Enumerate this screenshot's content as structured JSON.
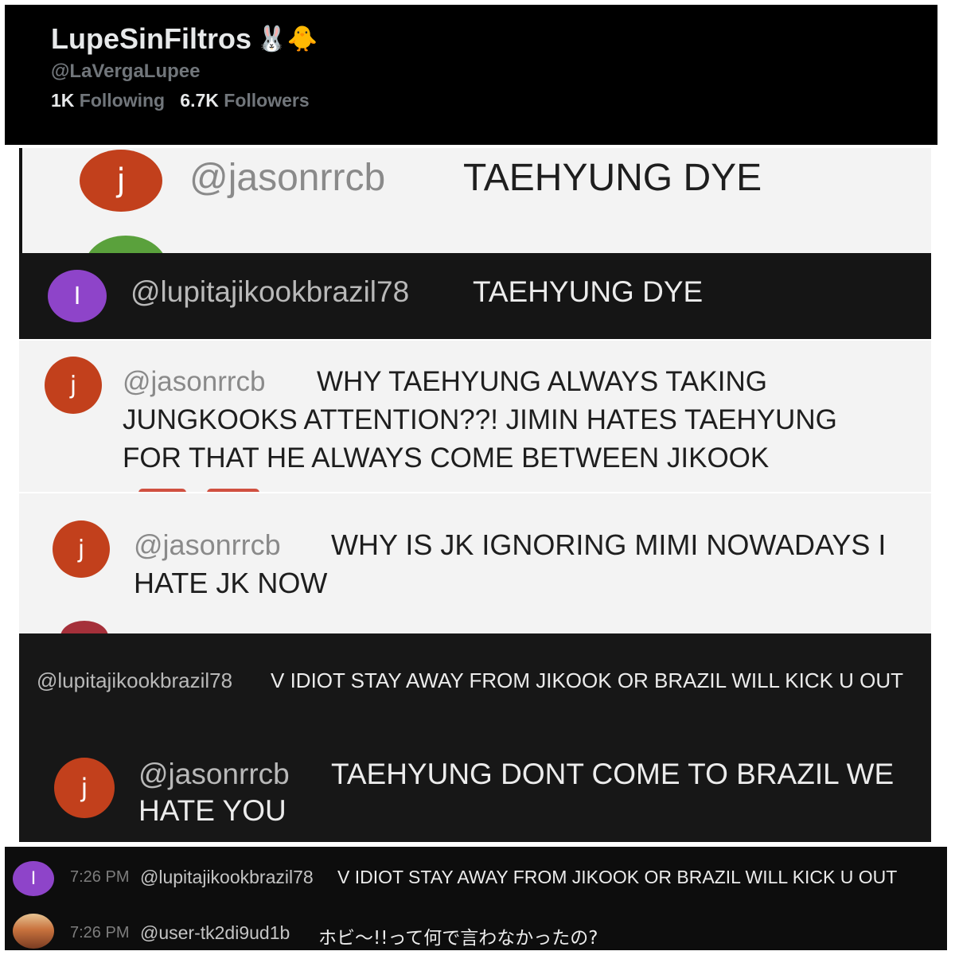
{
  "profile": {
    "name": "LupeSinFiltros",
    "emoji": "🐰🐥",
    "handle": "@LaVergaLupee",
    "following_count": "1K",
    "following_label": "Following",
    "followers_count": "6.7K",
    "followers_label": "Followers"
  },
  "comments": [
    {
      "avatar": "j",
      "handle": "@jasonrrcb",
      "text": "TAEHYUNG DYE"
    },
    {
      "avatar": "I",
      "handle": "@lupitajikookbrazil78",
      "text": "TAEHYUNG DYE"
    },
    {
      "avatar": "j",
      "handle": "@jasonrrcb",
      "text_lines": [
        "WHY TAEHYUNG ALWAYS TAKING",
        "JUNGKOOKS ATTENTION??! JIMIN HATES TAEHYUNG",
        "FOR THAT HE ALWAYS COME BETWEEN JIKOOK"
      ]
    },
    {
      "avatar": "j",
      "handle": "@jasonrrcb",
      "text_lines": [
        "WHY IS JK IGNORING MIMI NOWADAYS I",
        "HATE JK NOW"
      ]
    },
    {
      "handle": "@lupitajikookbrazil78",
      "text": "V IDIOT STAY AWAY FROM JIKOOK OR BRAZIL WILL KICK U OUT"
    },
    {
      "avatar": "j",
      "handle": "@jasonrrcb",
      "text_lines": [
        "TAEHYUNG DONT COME TO BRAZIL WE",
        "HATE YOU"
      ]
    }
  ],
  "chat": [
    {
      "avatar": "I",
      "time": "7:26 PM",
      "handle": "@lupitajikookbrazil78",
      "text": "V IDIOT STAY AWAY FROM JIKOOK OR BRAZIL WILL KICK U OUT"
    },
    {
      "time": "7:26 PM",
      "handle": "@user-tk2di9ud1b",
      "text": "ホビ〜!!って何で言わなかったの?"
    }
  ],
  "colors": {
    "avatar_red": "#c2401c",
    "avatar_purple": "#8e44c9",
    "avatar_green": "#5aa13c"
  }
}
